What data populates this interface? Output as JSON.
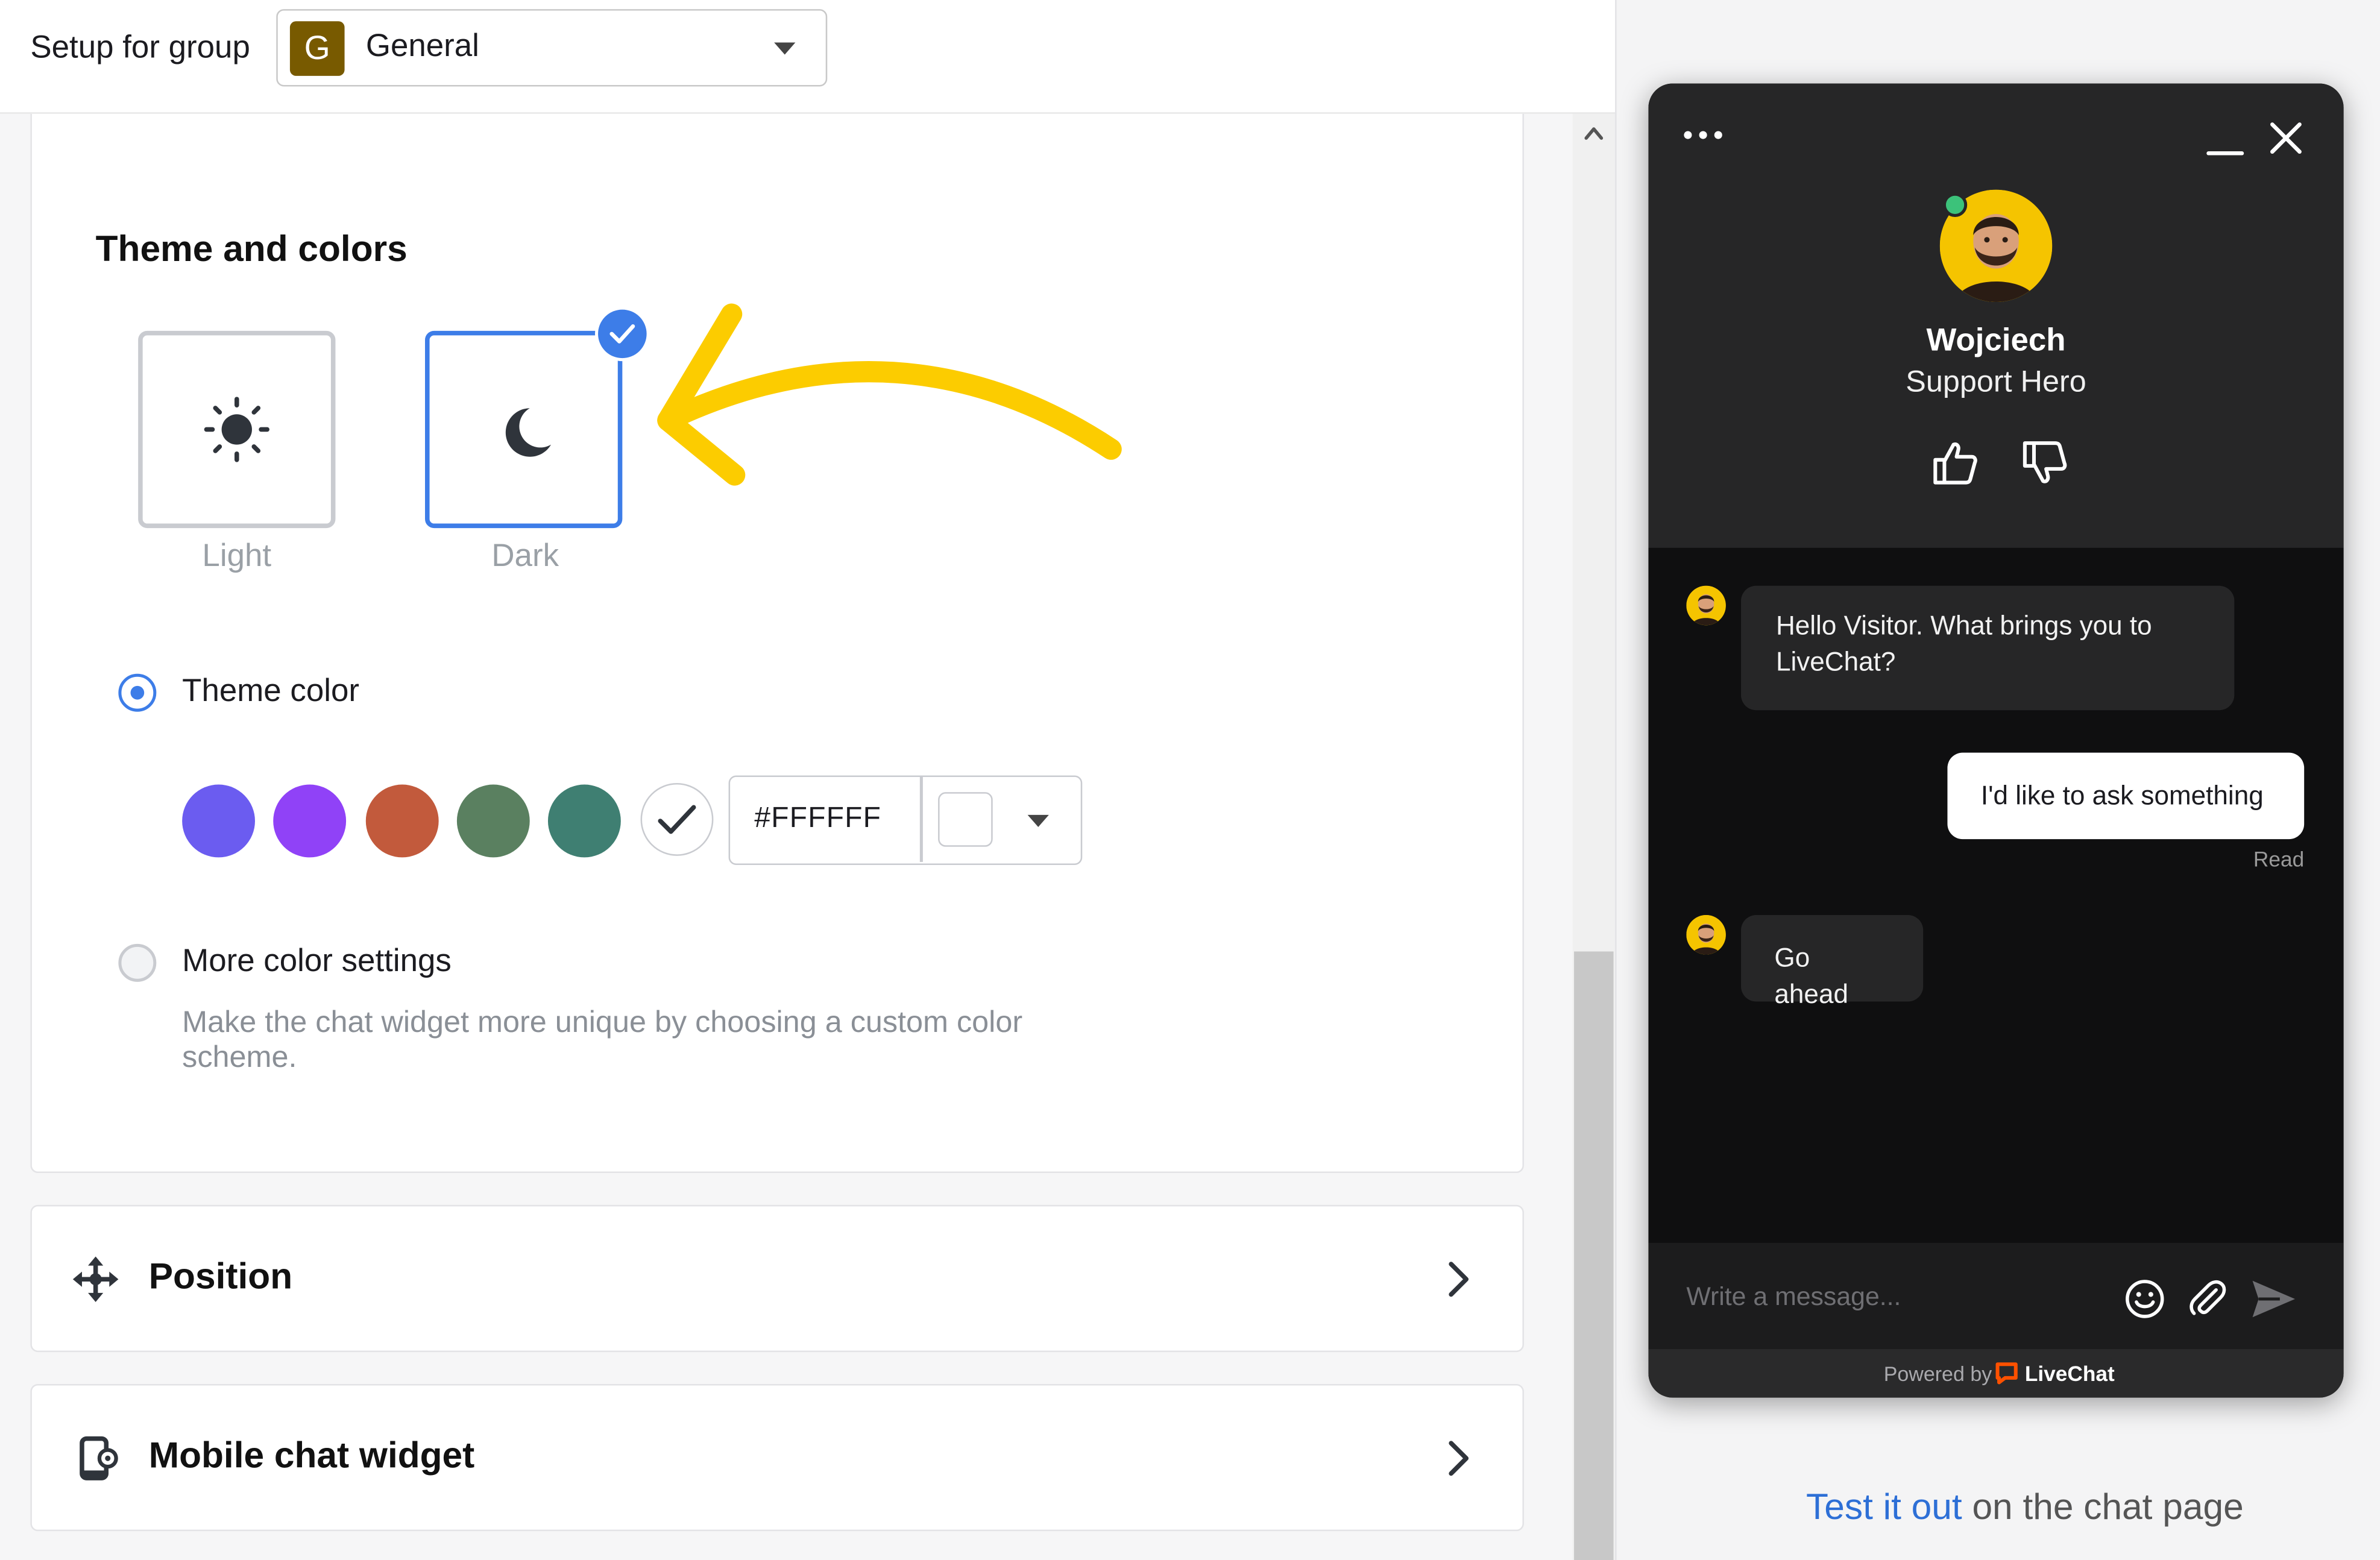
{
  "topbar": {
    "setup_label": "Setup for group",
    "group": {
      "avatar_letter": "G",
      "name": "General"
    }
  },
  "theme_section": {
    "title": "Theme and colors",
    "themes": [
      {
        "label": "Light",
        "icon": "sun-icon",
        "selected": false
      },
      {
        "label": "Dark",
        "icon": "moon-icon",
        "selected": true
      }
    ],
    "theme_color": {
      "label": "Theme color",
      "selected": true,
      "swatches": [
        "#6b5cf0",
        "#9042f7",
        "#c25a3c",
        "#5a8060",
        "#3f7f72",
        "#ffffff"
      ],
      "selected_swatch": "#ffffff",
      "hex_value": "#FFFFFF"
    },
    "more_colors": {
      "label": "More color settings",
      "description": "Make the chat widget more unique by choosing a custom color scheme.",
      "selected": false
    }
  },
  "sections": [
    {
      "title": "Position",
      "icon": "move-arrows-icon"
    },
    {
      "title": "Mobile chat widget",
      "icon": "mobile-settings-icon"
    }
  ],
  "widget": {
    "agent": {
      "name": "Wojciech",
      "role": "Support Hero",
      "status_color": "#3cc27a"
    },
    "messages": [
      {
        "from": "agent",
        "text": "Hello Visitor. What brings you to LiveChat?"
      },
      {
        "from": "visitor",
        "text": "I'd like to ask something",
        "status": "Read"
      },
      {
        "from": "agent",
        "text": "Go ahead"
      }
    ],
    "composer_placeholder": "Write a message...",
    "powered_by": "Powered by",
    "brand": "LiveChat",
    "brand_color": "#ff5100"
  },
  "test_line": {
    "link": "Test it out",
    "rest": " on the chat page"
  },
  "colors": {
    "accent": "#3d7de8",
    "annotation_arrow": "#fccc00",
    "widget_bg": "#0f0f10"
  }
}
